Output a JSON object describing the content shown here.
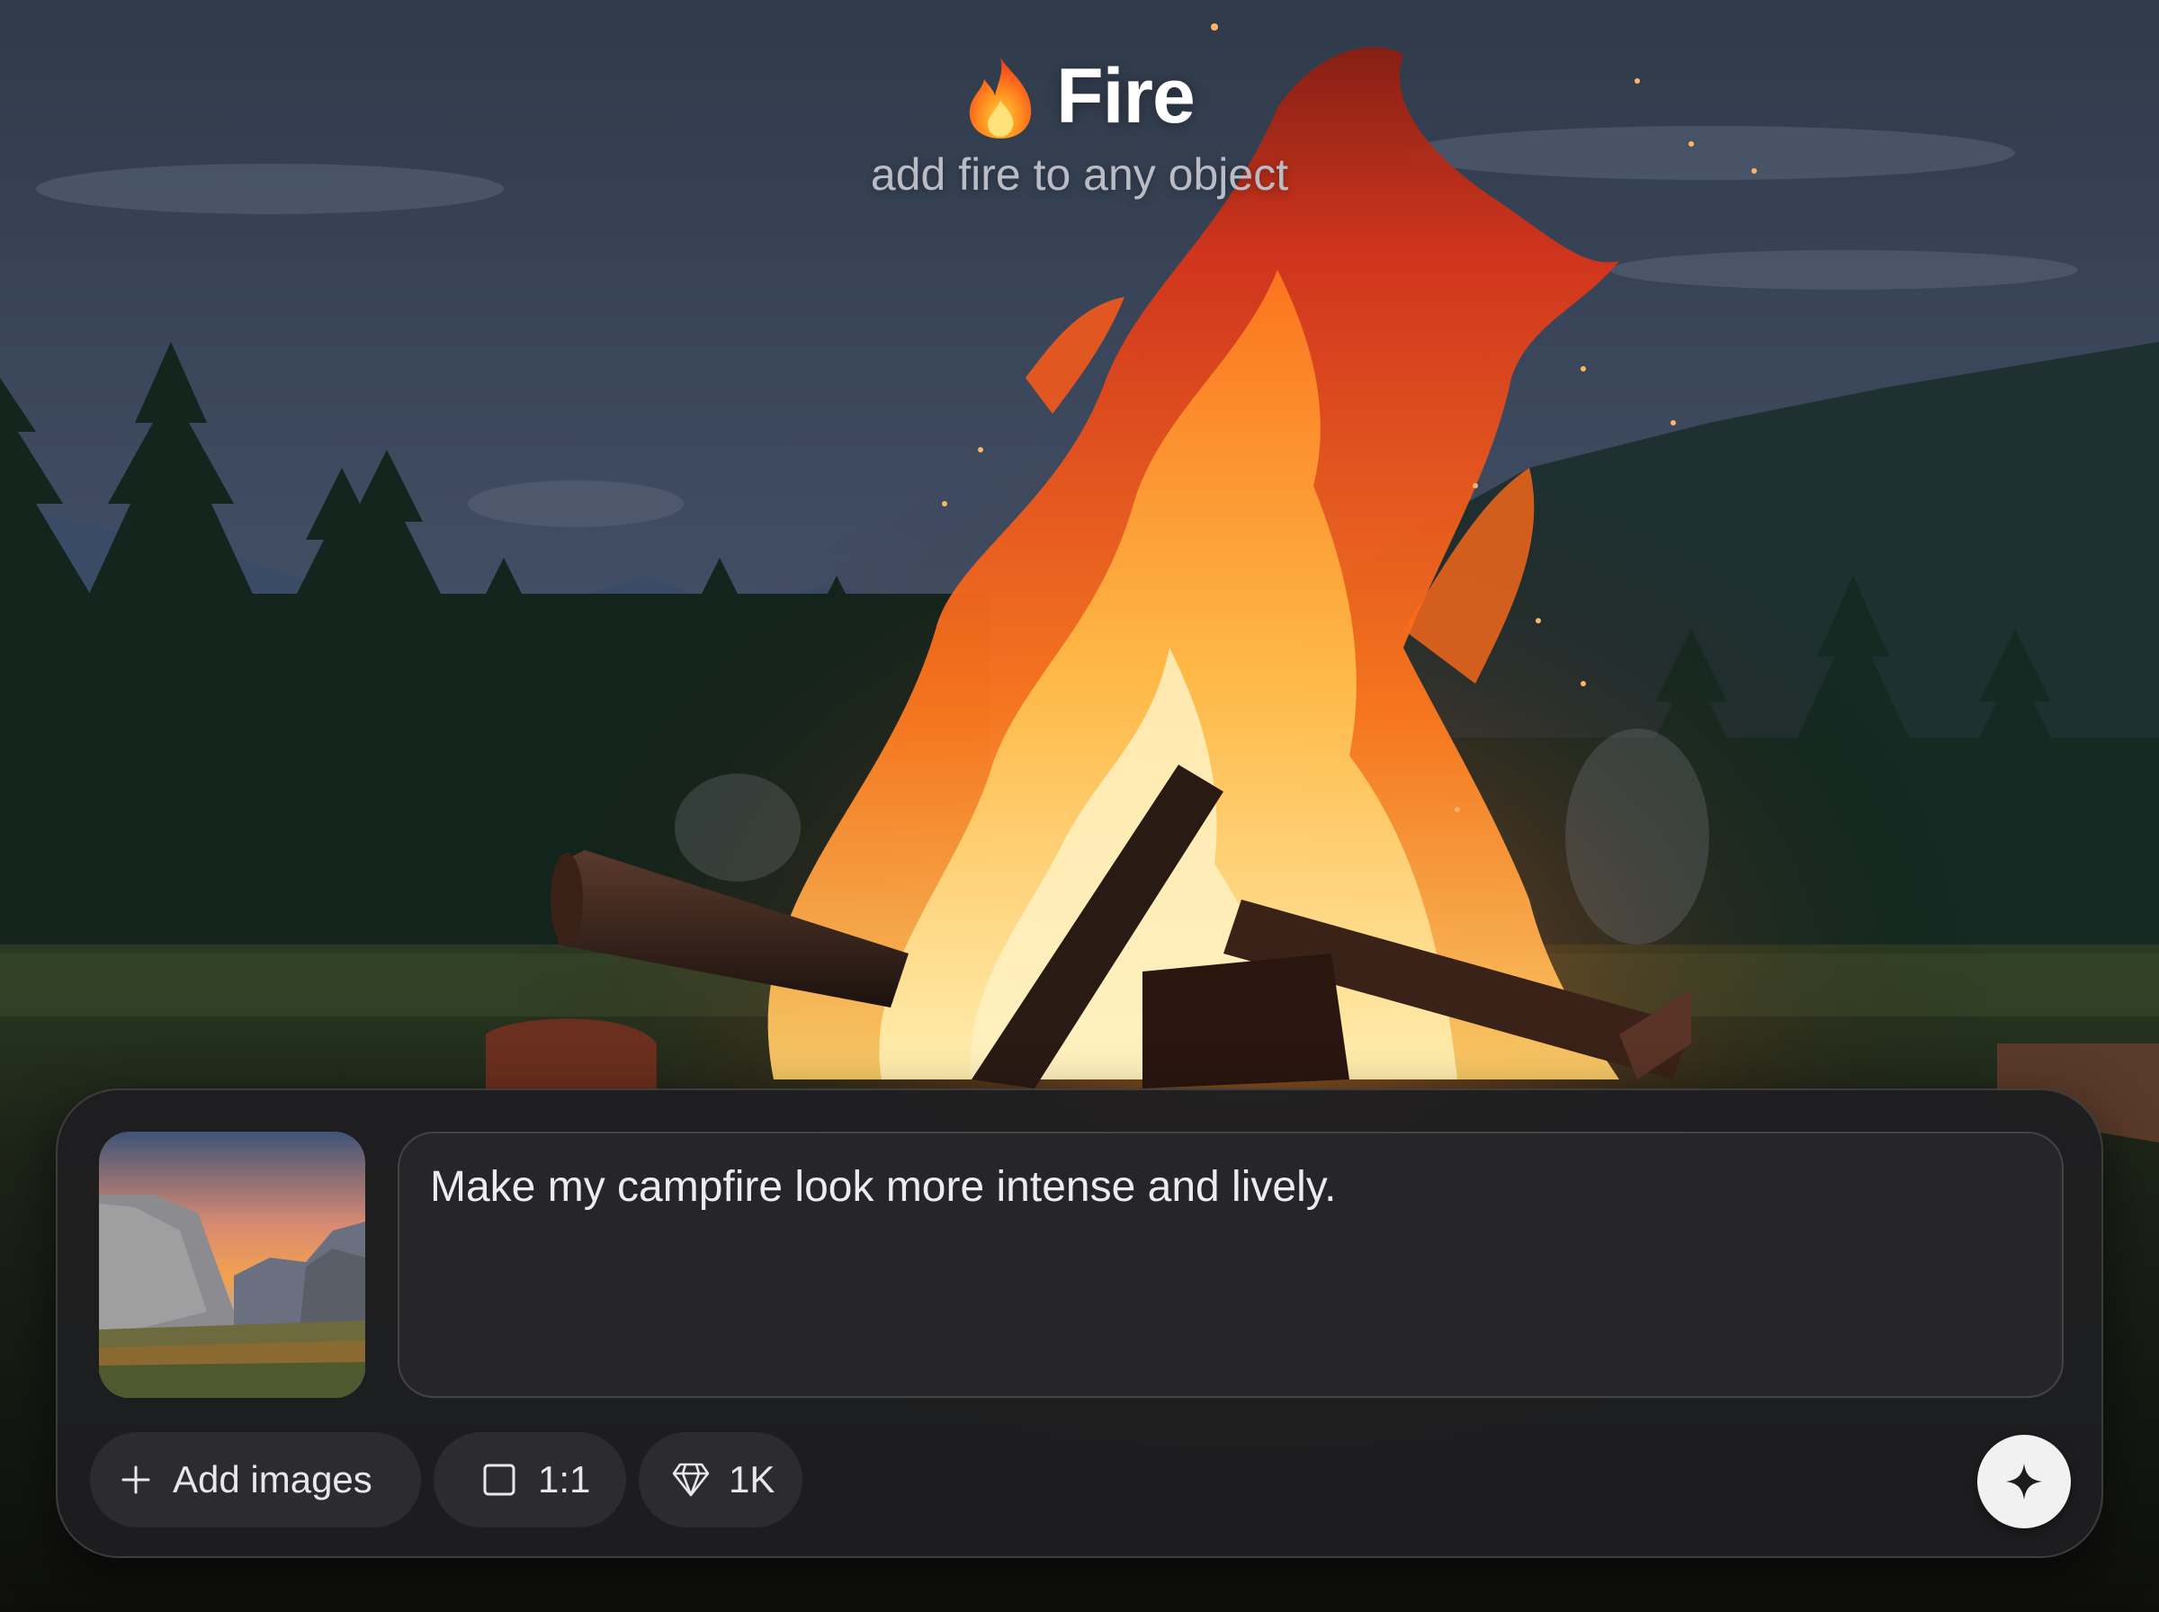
{
  "header": {
    "icon": "fire-icon",
    "title": "Fire",
    "subtitle": "add fire to any object"
  },
  "composer": {
    "reference_image": "mountain-valley-sunset-thumbnail",
    "prompt_text": "Make my campfire look more intense and lively.",
    "toolbar": {
      "add_images": {
        "icon": "plus-icon",
        "label": "Add images"
      },
      "aspect_ratio": {
        "icon": "square-icon",
        "label": "1:1"
      },
      "quality": {
        "icon": "diamond-icon",
        "label": "1K"
      }
    },
    "send_button": {
      "icon": "sparkle-icon"
    }
  },
  "colors": {
    "panel_bg": "#1e1e20",
    "chip_bg": "#2c2c2f",
    "send_bg": "#f1f1f2",
    "title": "#ffffff",
    "subtitle": "#b9bcc4"
  }
}
